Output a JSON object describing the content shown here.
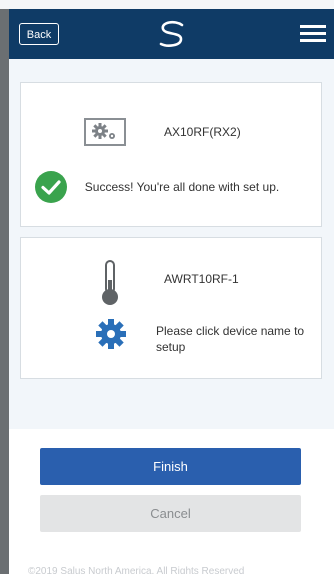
{
  "header": {
    "back_label": "Back",
    "logo_icon": "s-swirl-logo",
    "menu_icon": "hamburger-menu-icon",
    "bg_color": "#0f3b66"
  },
  "cards": [
    {
      "device_name": "AX10RF(RX2)",
      "icon": "gear-device-box-icon",
      "status_icon": "check-circle-icon",
      "status_color": "#3aa34d",
      "status_text": "Success! You're all done with set up."
    },
    {
      "device_name": "AWRT10RF-1",
      "icon": "thermometer-icon",
      "action_icon": "gear-icon",
      "action_color": "#2a6fb8",
      "action_text": "Please click device name to setup"
    }
  ],
  "buttons": {
    "finish_label": "Finish",
    "cancel_label": "Cancel",
    "finish_color": "#2a5fae"
  },
  "footer": {
    "text": "©2019 Salus North America. All Rights Reserved"
  }
}
